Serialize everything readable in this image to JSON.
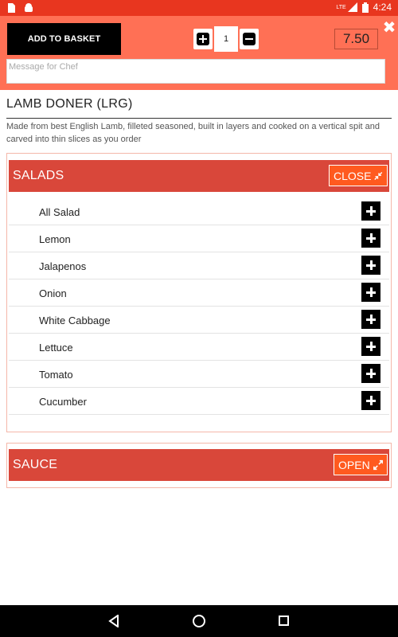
{
  "status_bar": {
    "time": "4:24",
    "icons": [
      "sd-card-icon",
      "android-icon",
      "lte-signal-icon",
      "battery-icon"
    ],
    "network_label": "LTE"
  },
  "header": {
    "add_to_basket_label": "ADD TO BASKET",
    "quantity": "1",
    "price": "7.50",
    "chef_message_placeholder": "Message for Chef",
    "close_symbol": "✖"
  },
  "product": {
    "name": "LAMB DONER (LRG)",
    "description": "Made from best English Lamb, filleted seasoned, built in layers and cooked on a vertical spit and carved into thin slices as you order"
  },
  "sections": {
    "salads": {
      "title": "SALADS",
      "toggle_label": "CLOSE",
      "items": [
        "All Salad",
        "Lemon",
        "Jalapenos",
        "Onion",
        "White Cabbage",
        "Lettuce",
        "Tomato",
        "Cucumber"
      ]
    },
    "sauce": {
      "title": "SAUCE",
      "toggle_label": "OPEN"
    }
  },
  "colors": {
    "status_bar": "#e8361f",
    "header": "#ff7055",
    "section_header": "#d9473a",
    "toggle_button": "#ff5a1f"
  }
}
